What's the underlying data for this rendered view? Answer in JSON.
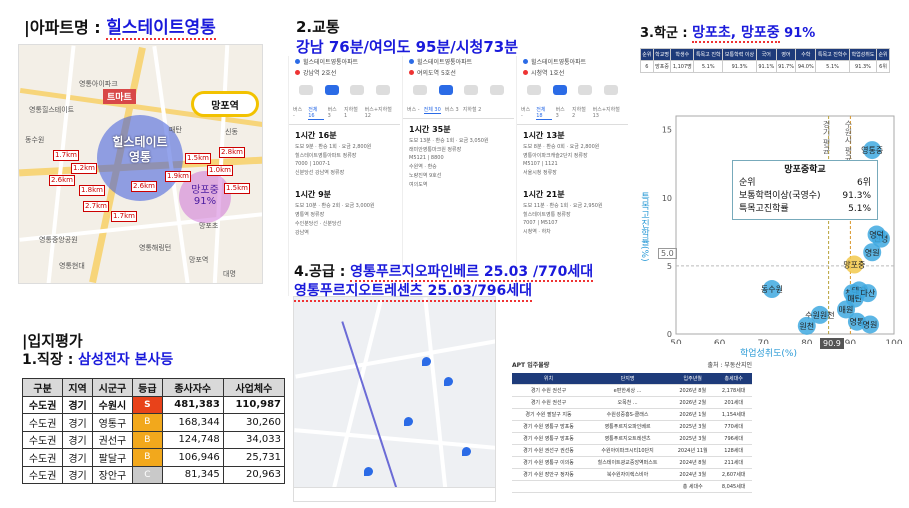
{
  "section1": {
    "title_prefix": "|아파트명 : ",
    "apt_name": "힐스테이트영통"
  },
  "map1": {
    "mart": "트마트",
    "station": "망포역",
    "apt_bubble_line1": "힐스테이트",
    "apt_bubble_line2": "영통",
    "school_bubble_line1": "망포중",
    "school_bubble_line2": "91%",
    "distances": [
      "1.7km",
      "1.2km",
      "2.6km",
      "1.8km",
      "2.6km",
      "1.5km",
      "2.8km",
      "1.0km",
      "1.5km",
      "2.7km",
      "1.7km",
      "1.9km"
    ],
    "places": [
      "영통아이파크",
      "영통힐스테이트",
      "영통중앙공원",
      "망포초",
      "영통해링턴",
      "신동",
      "동수원",
      "망포역",
      "영통현대",
      "대명",
      "매탄"
    ]
  },
  "section2": {
    "title": "2.교통",
    "times": "강남 76분/여의도 95분/시청73분"
  },
  "transit": {
    "cols": [
      {
        "from": "힐스테이트영통아파트",
        "to": "강남역 2호선",
        "tabs": [
          "버스 -",
          "전체 16",
          "버스 3",
          "지하철 1",
          "버스+지하철 12"
        ],
        "routes": [
          {
            "time": "1시간 16분",
            "meta": "도보 9분 · 환승 1회 · 요금 2,800원",
            "stops": [
              "힐스테이트영통아파트 정류장",
              "7000 | 1007-1",
              "신분당선 강남역 정류장"
            ]
          },
          {
            "time": "1시간 9분",
            "meta": "도보 10분 · 환승 2회 · 요금 3,000원",
            "stops": [
              "영통역 정류장",
              "수인분당선 · 신분당선",
              "강남역"
            ]
          }
        ]
      },
      {
        "from": "힐스테이트영통아파트",
        "to": "여의도역 5호선",
        "tabs": [
          "버스 -",
          "전체 30",
          "버스 3",
          "지하철 2"
        ],
        "routes": [
          {
            "time": "1시간 35분",
            "meta": "도보 13분 · 환승 1회 · 요금 3,050원",
            "stops": [
              "래미안영통마크원 정류장",
              "M5121 | 8800",
              "수원역 · 환승",
              "노량진역 9호선",
              "여의도역"
            ]
          }
        ]
      },
      {
        "from": "힐스테이트영통아파트",
        "to": "시청역 1호선",
        "tabs": [
          "버스 -",
          "전체 18",
          "버스 3",
          "지하철 2",
          "버스+지하철 13"
        ],
        "routes": [
          {
            "time": "1시간 13분",
            "meta": "도보 8분 · 환승 0회 · 요금 2,800원",
            "stops": [
              "영통아이파크캐슬2단지 정류장",
              "M5107 | 1121",
              "서울시청 정류장"
            ]
          },
          {
            "time": "1시간 21분",
            "meta": "도보 11분 · 환승 1회 · 요금 2,950원",
            "stops": [
              "힐스테이트영통 정류장",
              "7007 | M5107",
              "시청역 · 하차"
            ]
          }
        ]
      }
    ]
  },
  "section3": {
    "prefix": "3.학군 : ",
    "schools": "망포초, 망포중",
    "pct": "91%"
  },
  "school_table": {
    "headers": [
      "순위",
      "학교명",
      "학생수",
      "특목고 진학",
      "보통학력 이상",
      "국어",
      "영어",
      "수학",
      "특목고 진학수",
      "학업성취도",
      "순위"
    ],
    "row": [
      "6",
      "망포중",
      "1,107명",
      "5.1%",
      "91.3%",
      "91.1%",
      "91.7%",
      "94.0%",
      "5.1%",
      "91.3%",
      "6위"
    ]
  },
  "scatter": {
    "popup_title": "망포중학교",
    "popup_rows": [
      {
        "k": "순위",
        "v": "6위"
      },
      {
        "k": "보통학력이상(국영수)",
        "v": "91.3%"
      },
      {
        "k": "특목고진학률",
        "v": "5.1%"
      }
    ],
    "xlabel": "학업성취도(%)",
    "ylabel": "특목고진학률(%)",
    "y_tick": "5.0",
    "x_hover": "90.9",
    "vline_labels": [
      "경기 평균",
      "수원시 평균"
    ],
    "x_ticks": [
      "50",
      "60",
      "70",
      "80",
      "90",
      "100"
    ],
    "y_ticks": [
      "15",
      "10",
      "5",
      "0"
    ],
    "points": [
      {
        "name": "망포중",
        "x": 90.9,
        "y": 5.1,
        "focus": true
      },
      {
        "name": "영통중",
        "x": 95,
        "y": 13.5
      },
      {
        "name": "신영",
        "x": 97,
        "y": 7
      },
      {
        "name": "영덕",
        "x": 96,
        "y": 7.3
      },
      {
        "name": "영원",
        "x": 95,
        "y": 6
      },
      {
        "name": "동수원",
        "x": 72,
        "y": 3.3
      },
      {
        "name": "청명",
        "x": 90.5,
        "y": 3
      },
      {
        "name": "태장",
        "x": 92,
        "y": 3.2
      },
      {
        "name": "매탄",
        "x": 91,
        "y": 2.6
      },
      {
        "name": "다산",
        "x": 94,
        "y": 3
      },
      {
        "name": "수원원천",
        "x": 83,
        "y": 1.4
      },
      {
        "name": "매원",
        "x": 89,
        "y": 1.8
      },
      {
        "name": "영통",
        "x": 91.5,
        "y": 0.9
      },
      {
        "name": "명원",
        "x": 94.5,
        "y": 0.7
      },
      {
        "name": "원천",
        "x": 80,
        "y": 0.6
      }
    ]
  },
  "section4": {
    "title": "|입지평가",
    "job_prefix": "1.직장 : ",
    "job": "삼성전자 본사등"
  },
  "jobs_table": {
    "headers": [
      "구분",
      "지역",
      "시군구",
      "등급",
      "종사자수",
      "사업체수"
    ],
    "rows": [
      {
        "c": [
          "수도권",
          "경기",
          "수원시",
          "S",
          "481,383",
          "110,987"
        ],
        "color": "#e8421a"
      },
      {
        "c": [
          "수도권",
          "경기",
          "영통구",
          "B",
          "168,344",
          "30,260"
        ],
        "color": "#f2a81c"
      },
      {
        "c": [
          "수도권",
          "경기",
          "권선구",
          "B",
          "124,748",
          "34,033"
        ],
        "color": "#f2a81c"
      },
      {
        "c": [
          "수도권",
          "경기",
          "팔달구",
          "B",
          "106,946",
          "25,731"
        ],
        "color": "#f2a81c"
      },
      {
        "c": [
          "수도권",
          "경기",
          "장안구",
          "C",
          "81,345",
          "20,963"
        ],
        "color": "#c9c9c9"
      }
    ]
  },
  "section5": {
    "line1_prefix": "4.공급 : ",
    "line1": "영통푸르지오파인베르 25.03 /770세대",
    "line2": "영통푸르지오트레센츠 25.03/796세대"
  },
  "apt_supply": {
    "title": "APT 입주물량",
    "source": "출처 : 부동산지인",
    "headers": [
      "위치",
      "단지명",
      "입주년월",
      "총세대수"
    ],
    "rows": [
      [
        "경기 수원 권선구",
        "e편한세상 ...",
        "2026년 8월",
        "2,178세대"
      ],
      [
        "경기 수원 권선구",
        "오목천 ...",
        "2026년 2월",
        "201세대"
      ],
      [
        "경기 수원 팔달구 지동",
        "수원성중흥S-클래스",
        "2026년 1월",
        "1,154세대"
      ],
      [
        "경기 수원 영통구 망포동",
        "영통푸르지오파인베르",
        "2025년 3월",
        "770세대"
      ],
      [
        "경기 수원 영통구 망포동",
        "영통푸르지오트레센츠",
        "2025년 3월",
        "796세대"
      ],
      [
        "경기 수원 권선구 권선동",
        "수원아이파크시티10단지",
        "2024년 11월",
        "128세대"
      ],
      [
        "경기 수원 영통구 이의동",
        "힐스테이트광교중앙역퍼스트",
        "2024년 8월",
        "211세대"
      ],
      [
        "경기 수원 장안구 정자동",
        "북수원자이렉스비아",
        "2024년 3월",
        "2,607세대"
      ]
    ],
    "total_label": "총 세대수",
    "total": "8,045세대"
  },
  "colors": {
    "blue": "#1a1adb",
    "navy": "#1e3b7a",
    "accent": "#2b6be6"
  }
}
